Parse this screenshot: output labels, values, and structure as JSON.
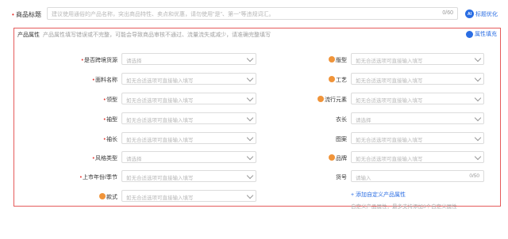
{
  "title_field": {
    "label": "商品标题",
    "placeholder": "建议使用通俗的产品名称，突出商品特性、卖点和优惠，请勿使用\"是\"、第一\"等违规词汇。",
    "count": "0/60",
    "ai_button": "标题优化"
  },
  "attributes": {
    "heading": "产品属性",
    "tip": "产品属性填写错误或不完整，可能会导致商品审核不通过、流量流失或减少，请准确完整填写",
    "fill_button": "属性填充",
    "left": [
      {
        "label": "是否跨境货源",
        "required": true,
        "badge": false,
        "placeholder": "请选择",
        "kind": "select"
      },
      {
        "label": "面料名称",
        "required": true,
        "badge": false,
        "placeholder": "如无合适选项可直接输入填写",
        "kind": "select"
      },
      {
        "label": "领型",
        "required": true,
        "badge": false,
        "placeholder": "如无合适选项可直接输入填写",
        "kind": "select"
      },
      {
        "label": "袖型",
        "required": true,
        "badge": false,
        "placeholder": "如无合适选项可直接输入填写",
        "kind": "select"
      },
      {
        "label": "袖长",
        "required": true,
        "badge": false,
        "placeholder": "如无合适选项可直接输入填写",
        "kind": "select"
      },
      {
        "label": "风格类型",
        "required": true,
        "badge": false,
        "placeholder": "请选择",
        "kind": "select"
      },
      {
        "label": "上市年份/季节",
        "required": true,
        "badge": false,
        "placeholder": "如无合适选项可直接输入填写",
        "kind": "select"
      },
      {
        "label": "款式",
        "required": false,
        "badge": true,
        "placeholder": "如无合适选项可直接输入填写",
        "kind": "select"
      }
    ],
    "right": [
      {
        "label": "版型",
        "badge": true,
        "placeholder": "如无合适选项可直接输入填写",
        "kind": "select"
      },
      {
        "label": "工艺",
        "badge": true,
        "placeholder": "如无合适选项可直接输入填写",
        "kind": "select"
      },
      {
        "label": "流行元素",
        "badge": true,
        "placeholder": "如无合适选项可直接输入填写",
        "kind": "select"
      },
      {
        "label": "衣长",
        "badge": false,
        "placeholder": "请选择",
        "kind": "select"
      },
      {
        "label": "图案",
        "badge": false,
        "placeholder": "如无合适选项可直接输入填写",
        "kind": "select"
      },
      {
        "label": "品牌",
        "badge": true,
        "placeholder": "如无合适选项可直接输入填写",
        "kind": "select"
      },
      {
        "label": "货号",
        "badge": false,
        "placeholder": "请输入",
        "kind": "input",
        "count": "0/50"
      }
    ],
    "add_custom": "+ 添加自定义产品属性",
    "add_hint": "自定义产品属性，最多支持添加3个自定义属性"
  }
}
